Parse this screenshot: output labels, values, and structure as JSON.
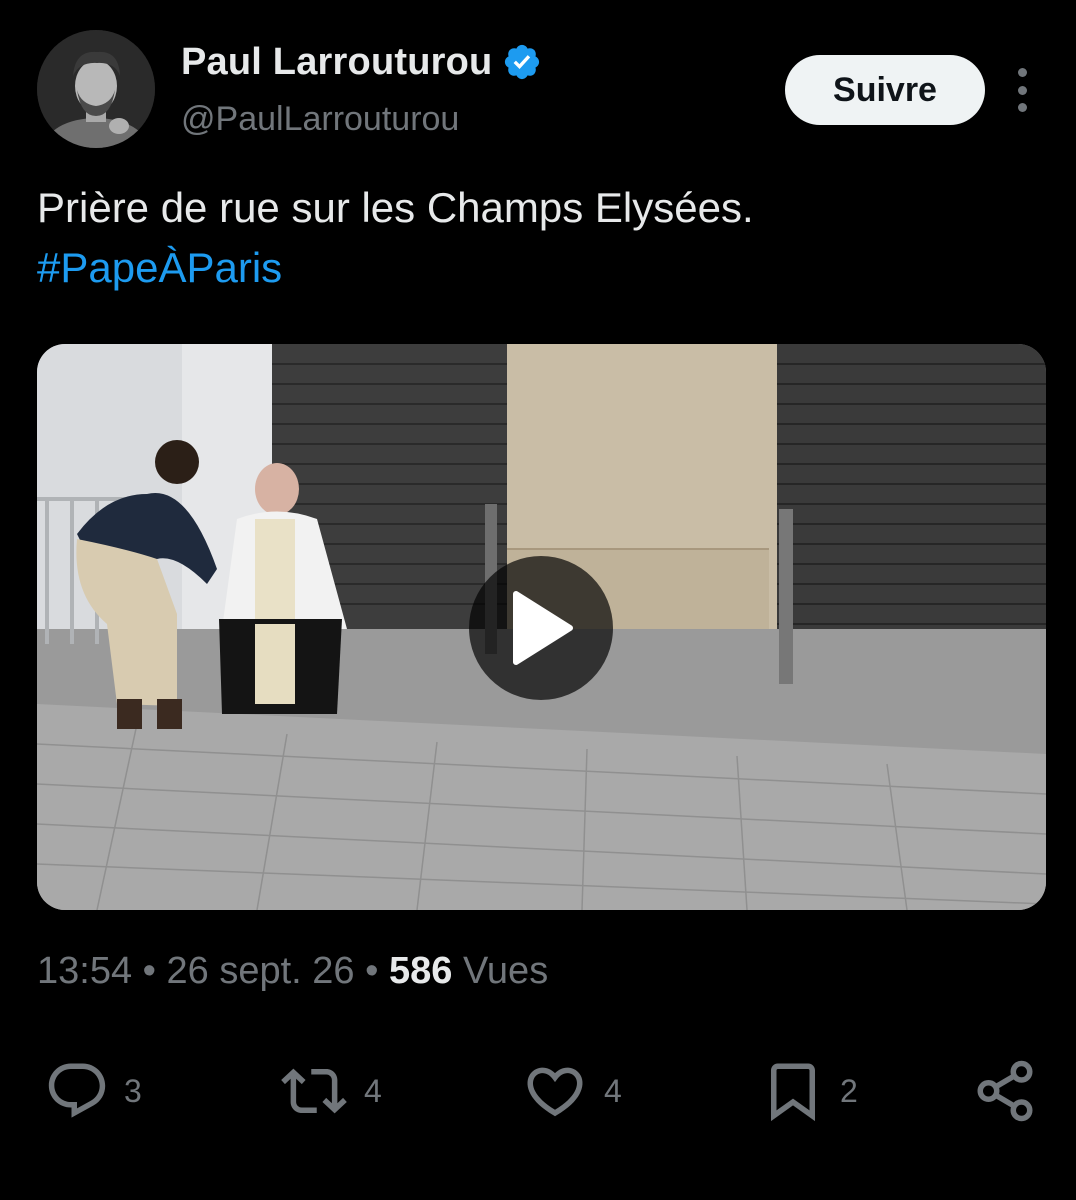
{
  "author": {
    "display_name": "Paul Larrouturou",
    "handle": "@PaulLarrouturou",
    "verified": true
  },
  "follow_button": {
    "label": "Suivre"
  },
  "tweet": {
    "text": "Prière de rue sur les Champs Elysées.",
    "hashtag": "#PapeÀParis"
  },
  "meta": {
    "time": "13:54",
    "separator": "•",
    "date": "26 sept. 26",
    "views_count": "586",
    "views_label": "Vues"
  },
  "actions": {
    "replies": "3",
    "retweets": "4",
    "likes": "4",
    "bookmarks": "2"
  },
  "icons": {
    "verified": "verified-badge-icon",
    "more": "more-options-icon",
    "play": "play-icon",
    "reply": "reply-icon",
    "retweet": "retweet-icon",
    "like": "heart-icon",
    "bookmark": "bookmark-icon",
    "share": "share-icon"
  },
  "colors": {
    "background": "#000000",
    "text": "#e7e9ea",
    "muted": "#71767b",
    "link": "#1d9bf0",
    "follow_button_bg": "#eff3f4"
  }
}
